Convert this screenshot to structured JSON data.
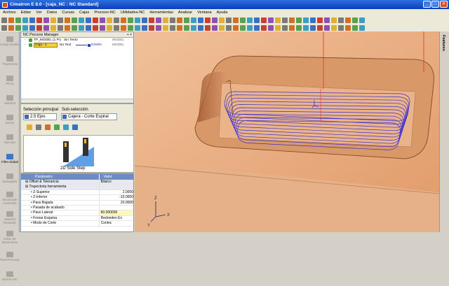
{
  "window": {
    "title": "Cimatron E 8.0 - [caja_NC : NC Standard]",
    "controls": [
      "_",
      "□",
      "×"
    ]
  },
  "menu": [
    "Archivo",
    "Editar",
    "Ver",
    "Datos",
    "Curvas",
    "Cajas",
    "Proceso-NC",
    "Utilidades-NC",
    "Herramientas",
    "Analizar",
    "Ventana",
    "Ayuda"
  ],
  "left_toolbar": [
    "Carga Modelo",
    "Trayectoria",
    "Pieza",
    "Material",
    "Borrar",
    "Ejecutar",
    "Filtro Global",
    "Navegador",
    "Simulación Avanzada",
    "Material Restante",
    "Editor de Movimiento",
    "Post-Procesar",
    "Informe-NC"
  ],
  "process_manager": {
    "title": "NC Process Manager",
    "rows": [
      {
        "name": "TP_MODEL (1 Pr)",
        "status": "Sin Texto",
        "extra": "",
        "type": "MODEL"
      },
      {
        "name": "Caja - 1",
        "status": "No Text",
        "extra": "D25R0",
        "type": "MODEL"
      }
    ]
  },
  "selection": {
    "main_label": "Selección principal",
    "sub_label": "Sub-selección",
    "main_value": "2.5 Ejes",
    "sub_value": "Cajera - Corte Espiral",
    "preview_caption": "2D Side Step"
  },
  "properties": {
    "col_name": "Parámetro",
    "col_value": "Valor",
    "rows": [
      {
        "name": "Offset & Tolerancia",
        "value": "Básico",
        "sec": true
      },
      {
        "name": "Trayectoria herramienta",
        "value": "",
        "sec": true
      },
      {
        "name": "Z-Superior",
        "value": "2.0000"
      },
      {
        "name": "Z-Inferior",
        "value": "-15.0000"
      },
      {
        "name": "Paso Bajada",
        "value": "20.0000"
      },
      {
        "name": "Pasada de acabado",
        "value": ""
      },
      {
        "name": "Paso Lateral",
        "value": "60.000000"
      },
      {
        "name": "Fresar Esquina",
        "value": "Redondeo Ex"
      },
      {
        "name": "Modo de Corte",
        "value": "Contra"
      }
    ]
  },
  "right_panel": {
    "label": "Features"
  },
  "viewport": {
    "axes": [
      "X",
      "Y",
      "Z"
    ]
  },
  "colors": {
    "title": "#0a3fb5",
    "part": "#e8a878",
    "toolpath": "#3b2fd0",
    "tool_axis": "#e83030"
  }
}
